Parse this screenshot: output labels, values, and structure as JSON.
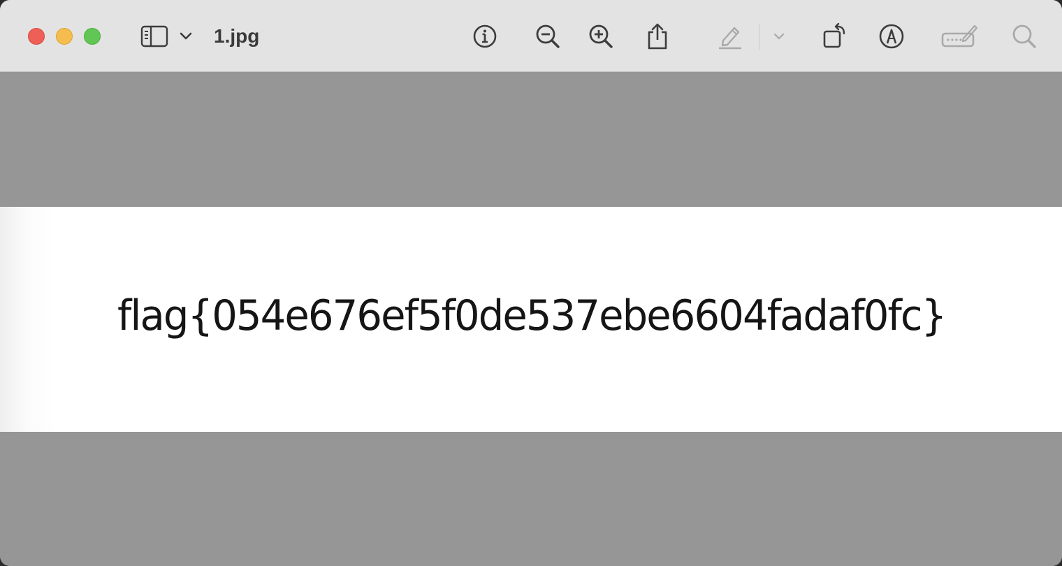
{
  "window": {
    "title": "1.jpg"
  },
  "toolbar": {
    "icons": [
      "sidebar-toggle-icon",
      "chevron-down-icon",
      "info-icon",
      "zoom-out-icon",
      "zoom-in-icon",
      "share-icon",
      "highlight-pen-icon",
      "chevron-down-icon",
      "rotate-icon",
      "markup-icon",
      "form-fill-icon",
      "search-icon"
    ]
  },
  "image": {
    "text": "flag{054e676ef5f0de537ebe6604fadaf0fc}"
  },
  "colors": {
    "close": "#ee5f57",
    "minimize": "#f5bd4f",
    "zoom": "#62c654",
    "toolbar_bg": "#e3e3e3",
    "canvas_bg": "#969696",
    "icon": "#3c3c3c",
    "icon_disabled": "#a9a9a9"
  }
}
